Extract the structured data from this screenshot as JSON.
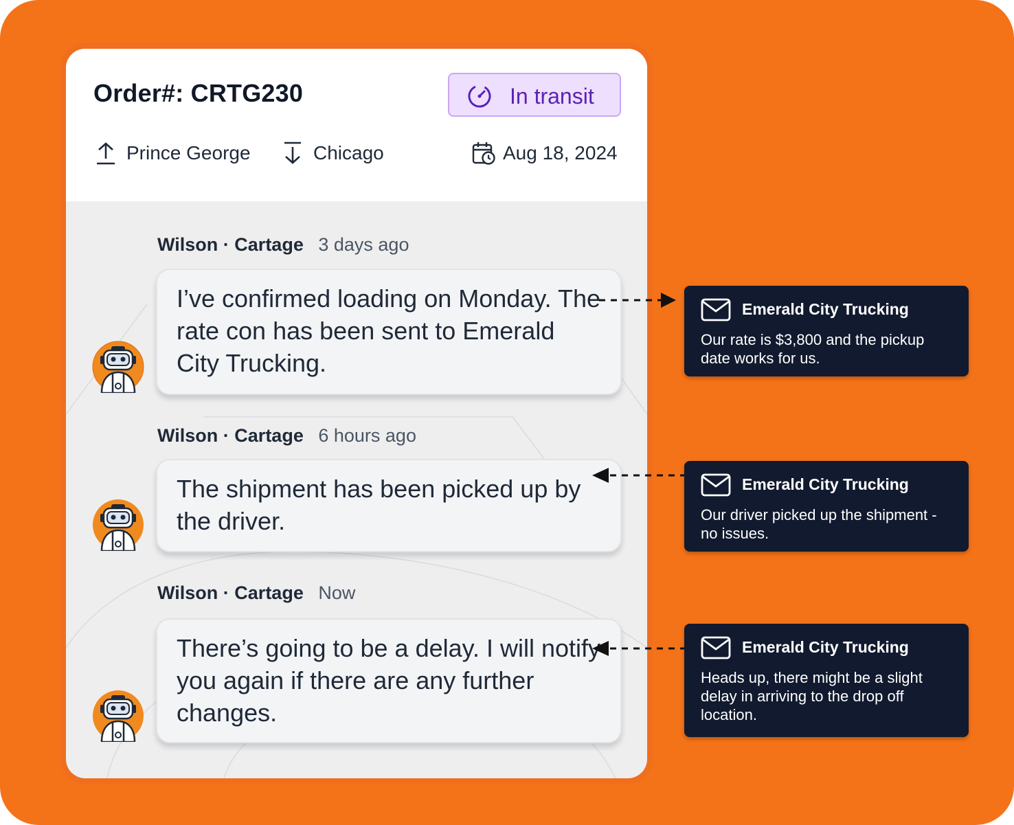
{
  "order": {
    "title": "Order#: CRTG230",
    "status": "In transit",
    "origin": "Prince George",
    "destination": "Chicago",
    "date": "Aug 18, 2024"
  },
  "messages": [
    {
      "author": "Wilson",
      "separator": "·",
      "company": "Cartage",
      "time": "3 days ago",
      "text": "I’ve confirmed loading on Monday. The rate con has been sent to Emerald City Trucking.",
      "direction": "outgoing"
    },
    {
      "author": "Wilson",
      "separator": "·",
      "company": "Cartage",
      "time": "6 hours ago",
      "text": "The shipment has been picked up by the driver.",
      "direction": "incoming"
    },
    {
      "author": "Wilson",
      "separator": "·",
      "company": "Cartage",
      "time": "Now",
      "text": "There’s going to be a delay. I will notify you again if there are any further changes.",
      "direction": "incoming"
    }
  ],
  "emails": [
    {
      "from": "Emerald City Trucking",
      "text": "Our rate is $3,800 and the pickup date works for us."
    },
    {
      "from": "Emerald City Trucking",
      "text": "Our driver picked up the shipment - no issues."
    },
    {
      "from": "Emerald City Trucking",
      "text": "Heads up, there might be a slight delay in arriving to the drop off location."
    }
  ],
  "colors": {
    "background": "#F57318",
    "badge_bg": "#EDDFFD",
    "badge_border": "#C9A6F5",
    "badge_text": "#5B21B6",
    "email_bg": "#111A2E"
  },
  "icons": [
    "gauge-icon",
    "upload-arrow-icon",
    "download-arrow-icon",
    "calendar-clock-icon",
    "robot-avatar-icon",
    "envelope-icon"
  ]
}
